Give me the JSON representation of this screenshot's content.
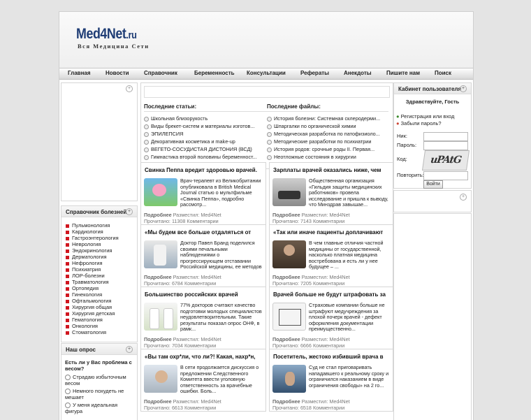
{
  "logo": {
    "name": "Med4Net",
    "tld": ".ru",
    "tagline": "Вся Медицина Сети"
  },
  "nav": [
    "Главная",
    "Новости",
    "Справочник",
    "Беременность",
    "Консультации",
    "Рефераты",
    "Анекдоты",
    "Пишите нам",
    "Поиск"
  ],
  "latest_articles": {
    "title": "Последние статьи:",
    "items": [
      "Школьная близорукость",
      "Виды брекет-систем и материалы изготов...",
      "ЭПИЛЕПСИЯ",
      "Декоративная косметика и make-up",
      "ВЕГЕТО-СОСУДИСТАЯ ДИСТОНИЯ (ВСД)",
      "Гимнастика второй половины беременност..."
    ]
  },
  "latest_files": {
    "title": "Последние файлы:",
    "items": [
      "История болезни: Системная склеродерми...",
      "Шпаргалки по органической химии",
      "Методическая разработка по патофизиоло...",
      "Методические разработки по психиатрии",
      "История родов: срочные роды II. Первая...",
      "Неотложные состояния в хирургии"
    ]
  },
  "meta_labels": {
    "more": "Подробнее",
    "posted": "Разместил:",
    "author": "Med4Net",
    "read": "Прочитано:",
    "comments": "Комментарии"
  },
  "articles": [
    {
      "title": "Свинка Пеппа вредит здоровью врачей.",
      "text": "Врач-терапевт из Великобритании опубликовала в British Medical Journal статью о мультфильме «Свинка Пеппа», подробно рассмотр...",
      "reads": "11308"
    },
    {
      "title": "Зарплаты врачей оказались ниже, чем",
      "text": "Общественная организация «Гильдия защиты медицинских работников» провела исследование и пришла к выводу, что Минздрав завышае...",
      "reads": "7143"
    },
    {
      "title": "«Мы будем все больше отдаляться от",
      "text": "Доктор Павел Бранд поделился своими печальными наблюдениями о прогрессирующем отставании Российской медицины, ее методов и по...",
      "reads": "6784"
    },
    {
      "title": "«Так или иначе пациенты доплачивают",
      "text": "В чем главные отличия частной медицины от государственной, насколько платная медицина востребована и есть ли у нее будущее – ...",
      "reads": "7205"
    },
    {
      "title": "Большинство российских врачей",
      "text": "77% докторов считают качество подготовки молодых специалистов неудовлетворительным. Такие результаты показал опрос ОНФ, в рамк...",
      "reads": "7034"
    },
    {
      "title": "Врачей больше не будут штрафовать за",
      "text": "Страховые компании больше не штрафуют медучреждения за плохой почерк врачей - дефект оформления документации преимущественно...",
      "reads": "6666"
    },
    {
      "title": "«Вы там охр*ли, что ли?! Какая, нахр*н,",
      "text": "В сети продолжается дискуссия о предложении Следственного Комитета ввести уголовную ответственность за врачебные ошибки. Боль...",
      "reads": "6613"
    },
    {
      "title": "Посетитель, жестоко избивший врача в",
      "text": "Суд не стал приговаривать нападавшего к реальному сроку и ограничился наказанием в виде ограничения свободы» на 2 го...",
      "reads": "6518"
    }
  ],
  "reference": {
    "title": "Справочник болезней",
    "items": [
      "Пульмонология",
      "Кардиология",
      "Гастроэнтерология",
      "Неврология",
      "Эндокринология",
      "Дерматология",
      "Нефрология",
      "Психиатрия",
      "ЛОР-болезни",
      "Травматология",
      "Ортопедия",
      "Гинекология",
      "Офтальмология",
      "Хирургия общая",
      "Хирургия детская",
      "Гематология",
      "Онкология",
      "Стоматология"
    ]
  },
  "poll": {
    "title": "Наш опрос",
    "question": "Есть ли у Вас проблема с весом?",
    "options": [
      "Страдаю избыточным весом",
      "Немного похудеть не мешает",
      "У меня идеальная фигура"
    ]
  },
  "cabinet": {
    "title": "Кабинет пользователя",
    "greeting": "Здравствуйте, Гость",
    "register": "Регистрация или вход",
    "forgot": "Забыли пароль?",
    "nick_label": "Ник:",
    "password_label": "Пароль:",
    "code_label": "Код:",
    "repeat_label": "Повторить:",
    "captcha": "uPAtG",
    "login_button": "Войти"
  },
  "colors": {
    "accent_red": "#d0161f",
    "logo_blue": "#1f3d75"
  }
}
